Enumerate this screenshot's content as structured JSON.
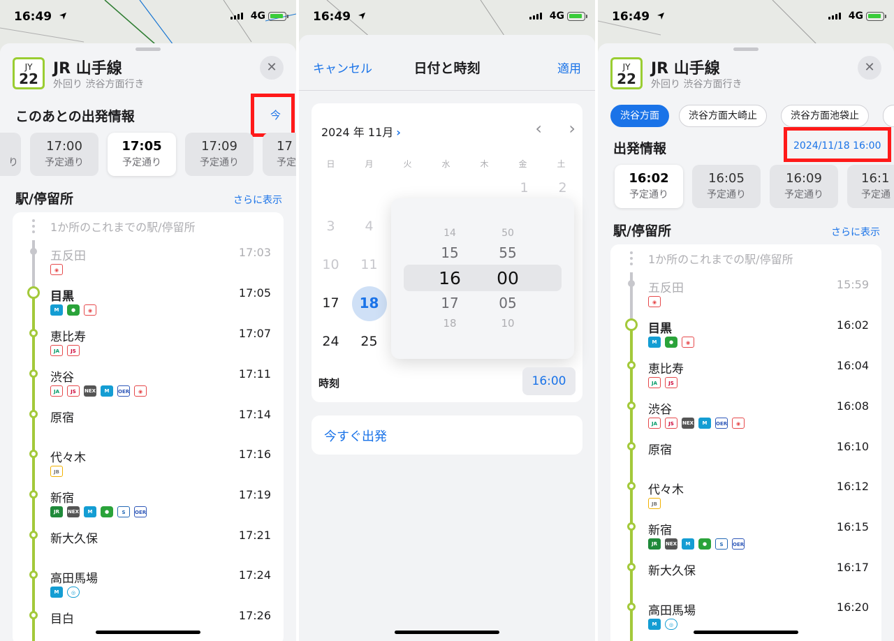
{
  "status": {
    "time": "16:49",
    "network": "4G"
  },
  "colors": {
    "accent": "#1a73e8",
    "line": "#a3c93a",
    "highlight": "#ff1a1a"
  },
  "line": {
    "code": "JY",
    "number": "22",
    "name": "JR 山手線",
    "direction": "外回り 渋谷方面行き"
  },
  "left": {
    "departures_heading": "このあとの出発情報",
    "now_button": "今",
    "departures": [
      {
        "time": "7",
        "status": "り"
      },
      {
        "time": "17:00",
        "status": "予定通り"
      },
      {
        "time": "17:05",
        "status": "予定通り"
      },
      {
        "time": "17:09",
        "status": "予定通り"
      },
      {
        "time": "17",
        "status": "予定"
      }
    ],
    "stops_heading": "駅/停留所",
    "more": "さらに表示",
    "prev_stops": "1か所のこれまでの駅/停留所",
    "stops": [
      {
        "name": "五反田",
        "time": "17:03",
        "icons": [
          "bus"
        ]
      },
      {
        "name": "目黒",
        "time": "17:05",
        "icons": [
          "metro",
          "toei",
          "bus"
        ]
      },
      {
        "name": "恵比寿",
        "time": "17:07",
        "icons": [
          "ja",
          "js"
        ]
      },
      {
        "name": "渋谷",
        "time": "17:11",
        "icons": [
          "ja",
          "js",
          "nex",
          "metro",
          "odakyu",
          "bus"
        ]
      },
      {
        "name": "原宿",
        "time": "17:14",
        "icons": []
      },
      {
        "name": "代々木",
        "time": "17:16",
        "icons": [
          "jb"
        ]
      },
      {
        "name": "新宿",
        "time": "17:19",
        "icons": [
          "jr",
          "nex",
          "metro",
          "toei",
          "seibu",
          "odakyu"
        ]
      },
      {
        "name": "新大久保",
        "time": "17:21",
        "icons": []
      },
      {
        "name": "高田馬場",
        "time": "17:24",
        "icons": [
          "metro",
          "tozai"
        ]
      },
      {
        "name": "目白",
        "time": "17:26",
        "icons": []
      }
    ]
  },
  "middle": {
    "cancel": "キャンセル",
    "title": "日付と時刻",
    "apply": "適用",
    "month": "2024 年 11月",
    "weekdays": [
      "日",
      "月",
      "火",
      "水",
      "木",
      "金",
      "土"
    ],
    "days_row1": [
      "1",
      "2"
    ],
    "days_row2": [
      "3",
      "4"
    ],
    "days_row3": [
      "10",
      "11"
    ],
    "days_row4": [
      "17",
      "18"
    ],
    "days_row5": [
      "24",
      "25"
    ],
    "selected_day": "18",
    "hours": [
      "14",
      "15",
      "16",
      "17",
      "18"
    ],
    "minutes": [
      "50",
      "55",
      "00",
      "05",
      "10"
    ],
    "time_label": "時刻",
    "time_value": "16:00",
    "now_depart": "今すぐ出発"
  },
  "right": {
    "chips": [
      "渋谷方面",
      "渋谷方面大崎止",
      "渋谷方面池袋止"
    ],
    "departures_heading": "出発情報",
    "date_time": "2024/11/18 16:00",
    "departures": [
      {
        "time": "16:02",
        "status": "予定通り"
      },
      {
        "time": "16:05",
        "status": "予定通り"
      },
      {
        "time": "16:09",
        "status": "予定通り"
      },
      {
        "time": "16:1",
        "status": "予定通"
      }
    ],
    "stops_heading": "駅/停留所",
    "more": "さらに表示",
    "prev_stops": "1か所のこれまでの駅/停留所",
    "stops": [
      {
        "name": "五反田",
        "time": "15:59",
        "icons": [
          "bus"
        ]
      },
      {
        "name": "目黒",
        "time": "16:02",
        "icons": [
          "metro",
          "toei",
          "bus"
        ]
      },
      {
        "name": "恵比寿",
        "time": "16:04",
        "icons": [
          "ja",
          "js"
        ]
      },
      {
        "name": "渋谷",
        "time": "16:08",
        "icons": [
          "ja",
          "js",
          "nex",
          "metro",
          "odakyu",
          "bus"
        ]
      },
      {
        "name": "原宿",
        "time": "16:10",
        "icons": []
      },
      {
        "name": "代々木",
        "time": "16:12",
        "icons": [
          "jb"
        ]
      },
      {
        "name": "新宿",
        "time": "16:15",
        "icons": [
          "jr",
          "nex",
          "metro",
          "toei",
          "seibu",
          "odakyu"
        ]
      },
      {
        "name": "新大久保",
        "time": "16:17",
        "icons": []
      },
      {
        "name": "高田馬場",
        "time": "16:20",
        "icons": [
          "metro",
          "tozai"
        ]
      }
    ]
  },
  "icon_text": {
    "ja": "JA",
    "js": "JS",
    "jb": "JB",
    "jr": "JR",
    "nex": "NEX",
    "metro": "M",
    "toei": "●",
    "bus": "◉",
    "seibu": "S",
    "odakyu": "OER",
    "tozai": "◎"
  }
}
